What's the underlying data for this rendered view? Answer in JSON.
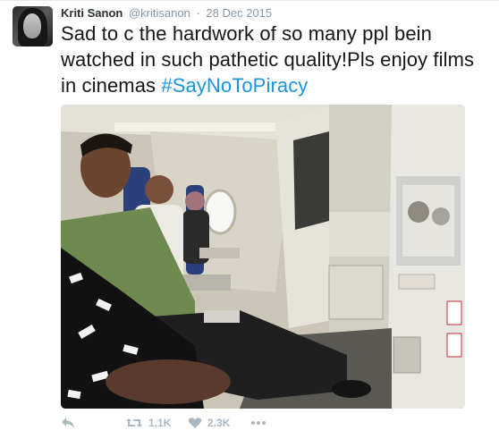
{
  "tweet": {
    "author_name": "Kriti Sanon",
    "author_handle": "@kritisanon",
    "separator": "·",
    "date": "28 Dec 2015",
    "text_main": "Sad to c the hardwork of so many ppl bein watched in such pathetic quality!Pls enjoy films in cinemas ",
    "hashtag": "#SayNoToPiracy"
  },
  "media": {
    "icon": "photo",
    "colors": {
      "seats": "#2b3f7a",
      "cabin_wall": "#d7d3c6",
      "screen": "#e8e6e0"
    }
  },
  "actions": {
    "reply_icon": "reply-icon",
    "retweet_icon": "retweet-icon",
    "retweet_count": "1.1K",
    "like_icon": "heart-icon",
    "like_count": "2.3K",
    "more_icon": "more-icon"
  },
  "colors": {
    "link": "#1b95e0",
    "meta": "#8899a6",
    "action": "#aab8c2"
  }
}
